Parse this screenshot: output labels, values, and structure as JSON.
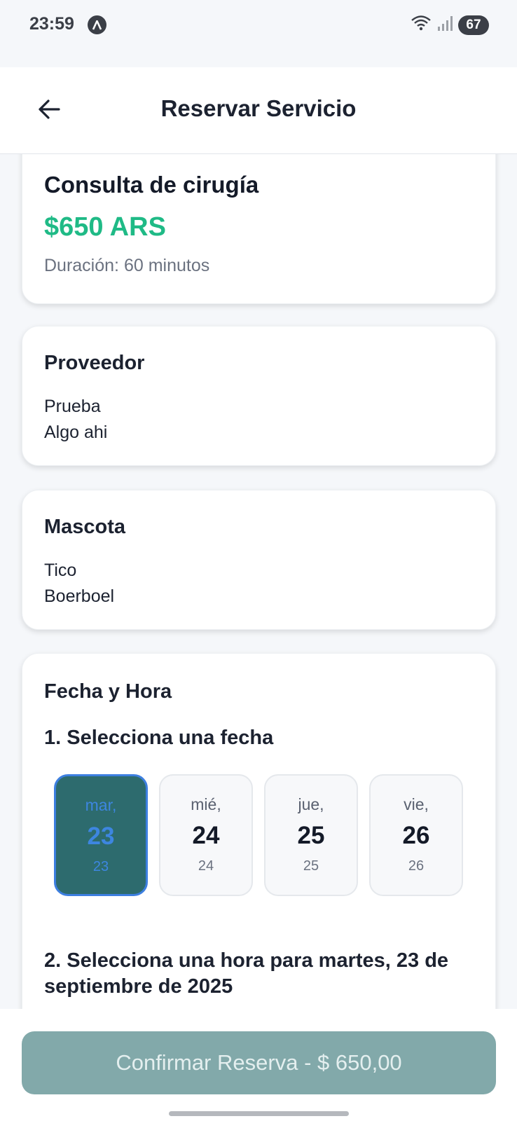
{
  "status_bar": {
    "time": "23:59",
    "notification_icon": "a-circle-icon",
    "battery": "67"
  },
  "header": {
    "title": "Reservar Servicio",
    "back_icon": "arrow-left-icon"
  },
  "service": {
    "title": "Consulta de cirugía",
    "price": "$650 ARS",
    "duration": "Duración: 60 minutos"
  },
  "provider": {
    "heading": "Proveedor",
    "name": "Prueba",
    "detail": "Algo ahi"
  },
  "pet": {
    "heading": "Mascota",
    "name": "Tico",
    "breed": "Boerboel"
  },
  "datetime": {
    "heading": "Fecha y Hora",
    "step1": "1. Selecciona una fecha",
    "dates": [
      {
        "day": "mar,",
        "num": "23",
        "small": "23",
        "selected": true
      },
      {
        "day": "mié,",
        "num": "24",
        "small": "24",
        "selected": false
      },
      {
        "day": "jue,",
        "num": "25",
        "small": "25",
        "selected": false
      },
      {
        "day": "vie,",
        "num": "26",
        "small": "26",
        "selected": false
      }
    ],
    "step2": "2. Selecciona una hora para martes, 23 de septiembre de 2025"
  },
  "confirm": {
    "label": "Confirmar Reserva - $ 650,00"
  },
  "colors": {
    "price": "#1fba86",
    "selected_date_bg": "#2d6b6e",
    "selected_date_border": "#3d7fe0",
    "confirm_button": "#82a9aa"
  }
}
